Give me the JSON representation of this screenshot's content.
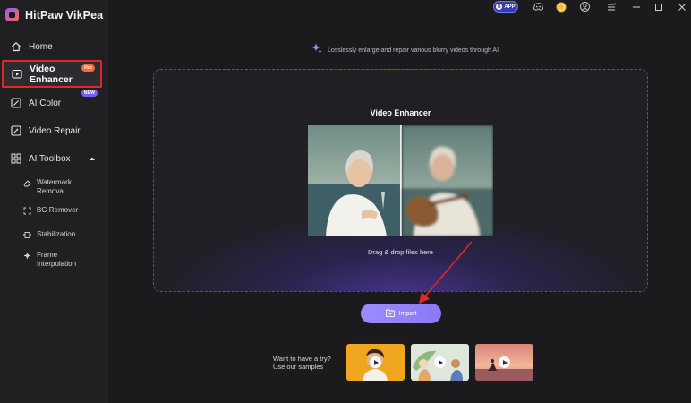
{
  "app": {
    "name": "HitPaw VikPea"
  },
  "titlebar": {
    "app_badge": "APP",
    "icons": [
      "discord-icon",
      "coin-icon",
      "user-icon",
      "menu-icon",
      "minimize-icon",
      "maximize-icon",
      "close-icon"
    ]
  },
  "sidebar": {
    "items": [
      {
        "label": "Home",
        "icon": "home-icon"
      },
      {
        "label": "Video Enhancer",
        "icon": "video-enhancer-icon",
        "badge": "Hot",
        "active": true
      },
      {
        "label": "AI Color",
        "icon": "ai-color-icon",
        "badge": "NEW"
      },
      {
        "label": "Video Repair",
        "icon": "video-repair-icon"
      },
      {
        "label": "AI Toolbox",
        "icon": "toolbox-icon",
        "expanded": true
      }
    ],
    "toolbox": [
      {
        "label": "Watermark Removal",
        "icon": "eraser-icon"
      },
      {
        "label": "BG Remover",
        "icon": "bg-remover-icon"
      },
      {
        "label": "Stabilization",
        "icon": "stabilization-icon"
      },
      {
        "label": "Frame Interpolation",
        "icon": "frame-interpolation-icon"
      }
    ]
  },
  "main": {
    "subtitle": "Losslessly enlarge and repair various blurry videos through AI",
    "dropzone": {
      "title": "Video Enhancer",
      "hint": "Drag & drop files here"
    },
    "import_label": "Import",
    "samples": {
      "prompt_line1": "Want to have a try?",
      "prompt_line2": "Use our samples"
    }
  },
  "colors": {
    "accent": "#8a7af5",
    "highlight": "#e0262c",
    "hot_badge": "#ff6a2c",
    "new_badge": "#7b5cff",
    "annotation_arrow": "#e0262c"
  }
}
